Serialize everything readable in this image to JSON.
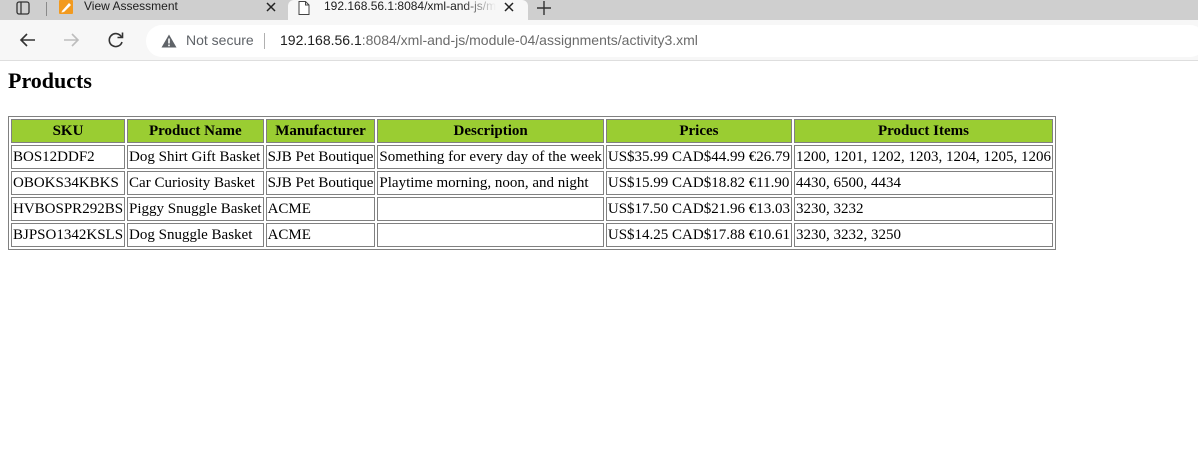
{
  "browser": {
    "tabs": [
      {
        "title": "View Assessment",
        "favicon": "pencil-note-icon",
        "active": false
      },
      {
        "title": "192.168.56.1:8084/xml-and-js/module-04/assignments/activity3.xml",
        "favicon": "document-icon",
        "active": true
      }
    ],
    "new_tab_icon": "plus-icon",
    "address_bar": {
      "security_icon": "warning-triangle-icon",
      "security_label": "Not secure",
      "url_host": "192.168.56.1",
      "url_rest": ":8084/xml-and-js/module-04/assignments/activity3.xml"
    },
    "nav_icons": [
      "back-arrow-icon",
      "forward-arrow-icon",
      "reload-icon"
    ]
  },
  "page": {
    "heading": "Products",
    "table": {
      "header_color": "#9acd32",
      "columns": [
        "SKU",
        "Product Name",
        "Manufacturer",
        "Description",
        "Prices",
        "Product Items"
      ],
      "rows": [
        [
          "BOS12DDF2",
          "Dog Shirt Gift Basket",
          "SJB Pet Boutique",
          "Something for every day of the week",
          "US$35.99 CAD$44.99 €26.79",
          "1200, 1201, 1202, 1203, 1204, 1205, 1206"
        ],
        [
          "OBOKS34KBKS",
          "Car Curiosity Basket",
          "SJB Pet Boutique",
          "Playtime morning, noon, and night",
          "US$15.99 CAD$18.82 €11.90",
          "4430, 6500, 4434"
        ],
        [
          "HVBOSPR292BS",
          "Piggy Snuggle Basket",
          "ACME",
          "",
          "US$17.50 CAD$21.96 €13.03",
          "3230, 3232"
        ],
        [
          "BJPSO1342KSLS",
          "Dog Snuggle Basket",
          "ACME",
          "",
          "US$14.25 CAD$17.88 €10.61",
          "3230, 3232, 3250"
        ]
      ]
    }
  }
}
